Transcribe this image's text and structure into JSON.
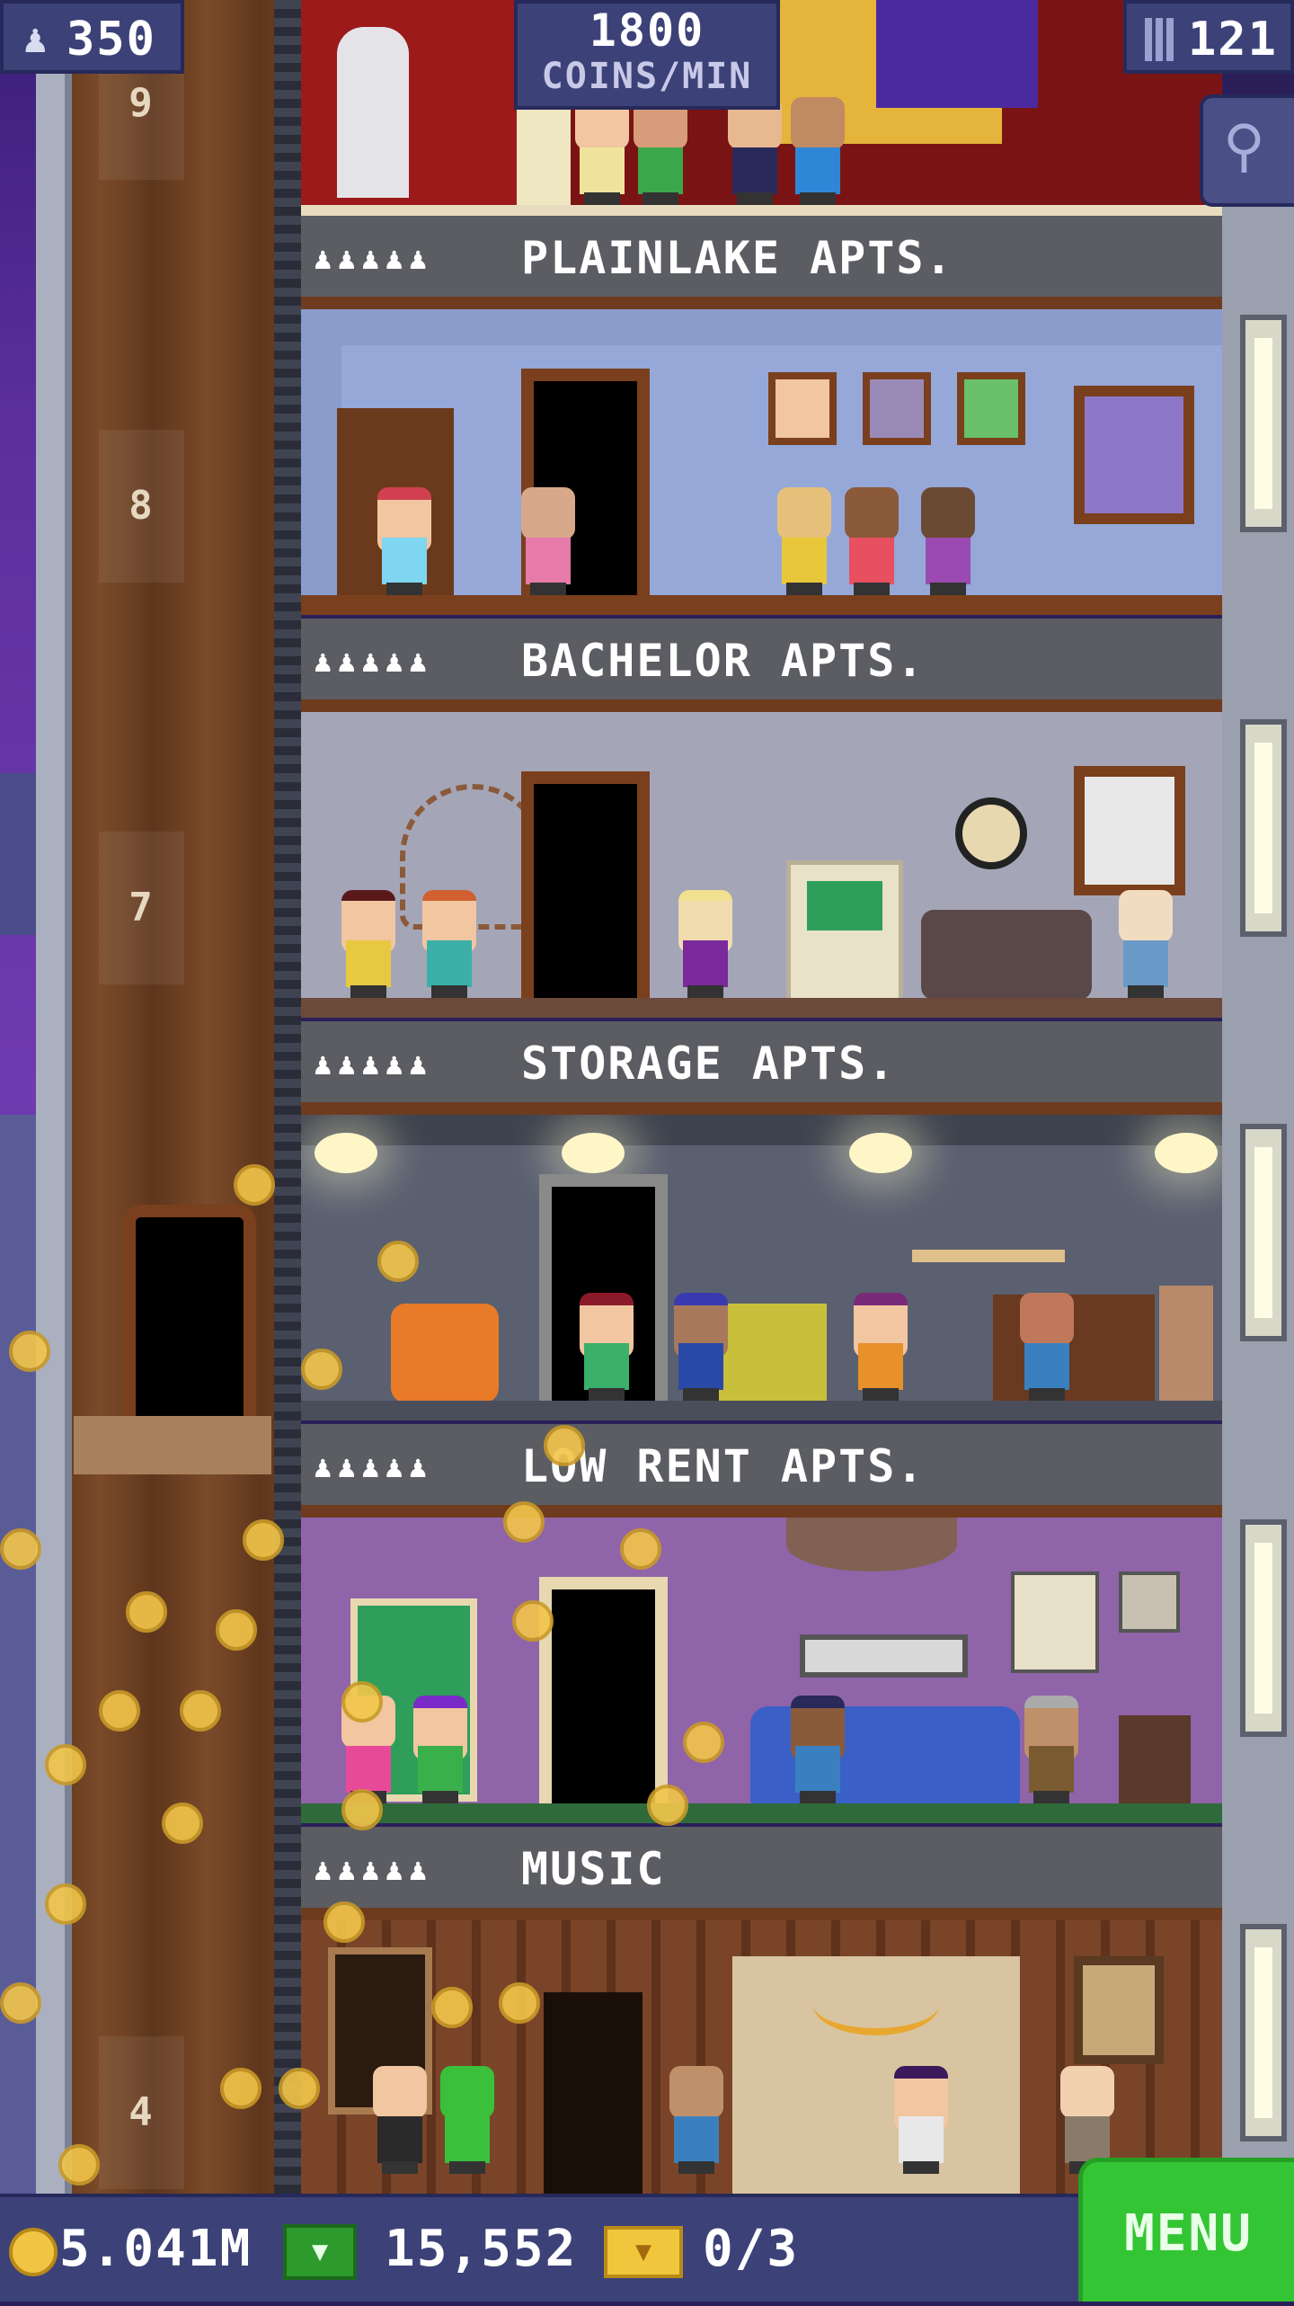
{
  "header": {
    "population": "350",
    "rate_value": "1800",
    "rate_unit": "COINS/MIN",
    "stories": "121"
  },
  "icons": {
    "population": "person-icon",
    "stories": "building-icon",
    "search": "magnifier-icon",
    "coins": "coin-icon",
    "bux": "tower-bux-icon",
    "tickets": "vip-ticket-icon"
  },
  "shaft": {
    "floor_numbers": [
      "9",
      "8",
      "7",
      "4"
    ]
  },
  "floors": [
    {
      "name": "PLAINLAKE APTS.",
      "people_icons": "♟♟♟♟♟"
    },
    {
      "name": "BACHELOR APTS.",
      "people_icons": "♟♟♟♟♟"
    },
    {
      "name": "STORAGE APTS.",
      "people_icons": "♟♟♟♟♟"
    },
    {
      "name": "LOW RENT APTS.",
      "people_icons": "♟♟♟♟♟"
    },
    {
      "name": "MUSIC",
      "people_icons": "♟♟♟♟♟"
    }
  ],
  "footer": {
    "coins": "5.041M",
    "bux": "15,552",
    "tickets": "0/3",
    "menu_label": "MENU"
  },
  "colors": {
    "accent_menu": "#34c534",
    "hud_bg": "#3c4278",
    "coin": "#f3c64a"
  }
}
